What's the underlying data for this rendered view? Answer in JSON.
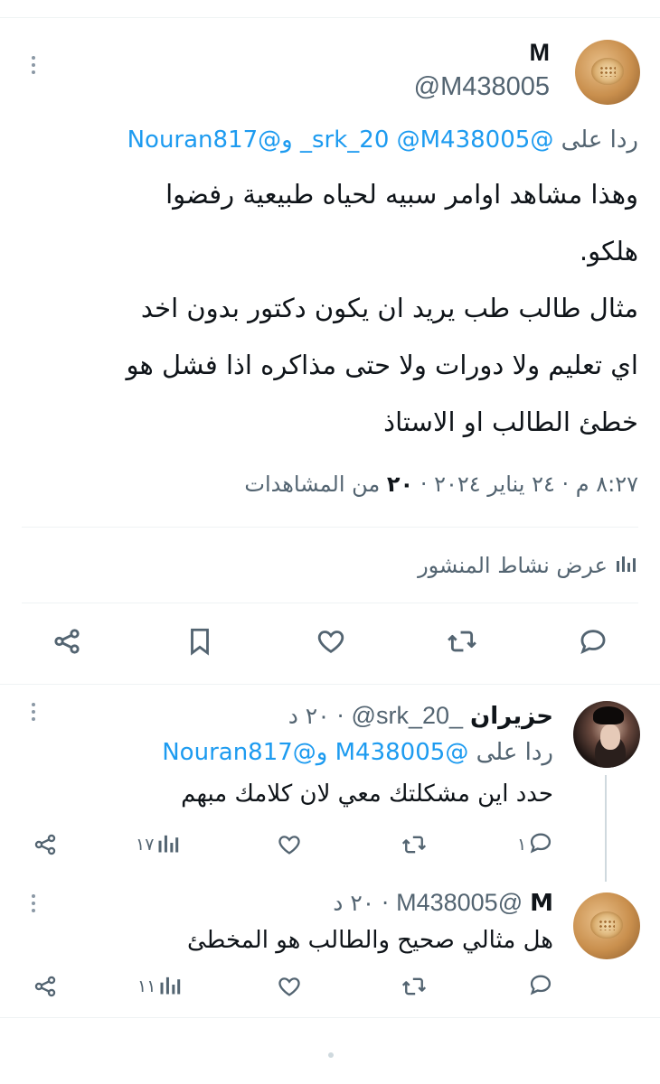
{
  "main_tweet": {
    "display_name": "M",
    "handle": "@M438005",
    "reply_to_label": "ردا على",
    "reply_to_handles": "@srk_20 @M438005_ و@Nouran817",
    "text": "وهذا مشاهد اوامر سبيه لحياه طبيعية رفضوا\nهلكو.\nمثال طالب طب يريد ان يكون دكتور بدون اخد\nاي تعليم ولا دورات ولا حتى مذاكره اذا فشل هو\nخطئ الطالب او الاستاذ",
    "timestamp": "٨:٢٧ م · ٢٤ يناير ٢٠٢٤ ·",
    "views_count": "٢٠",
    "views_label": "من المشاهدات",
    "activity_label": "عرض نشاط المنشور",
    "actions": [
      "reply",
      "retweet",
      "like",
      "bookmark",
      "share"
    ]
  },
  "replies": [
    {
      "display_name": "حزيران",
      "handle": "_srk_20@",
      "time": "· ٢٠ د",
      "reply_to_label": "ردا على",
      "reply_to_handles": "@M438005 و@Nouran817",
      "text": "حدد اين مشكلتك معي لان كلامك مبهم",
      "reply_count": "١",
      "views_count": "١٧"
    },
    {
      "display_name": "M",
      "handle": "@M438005",
      "time": "· ٢٠ د",
      "text": "هل مثالي صحيح والطالب هو المخطئ",
      "reply_count": "",
      "views_count": "١١"
    }
  ],
  "colors": {
    "link": "#1d9bf0",
    "muted": "#536471",
    "text": "#0f1419",
    "divider": "#eff3f4"
  }
}
